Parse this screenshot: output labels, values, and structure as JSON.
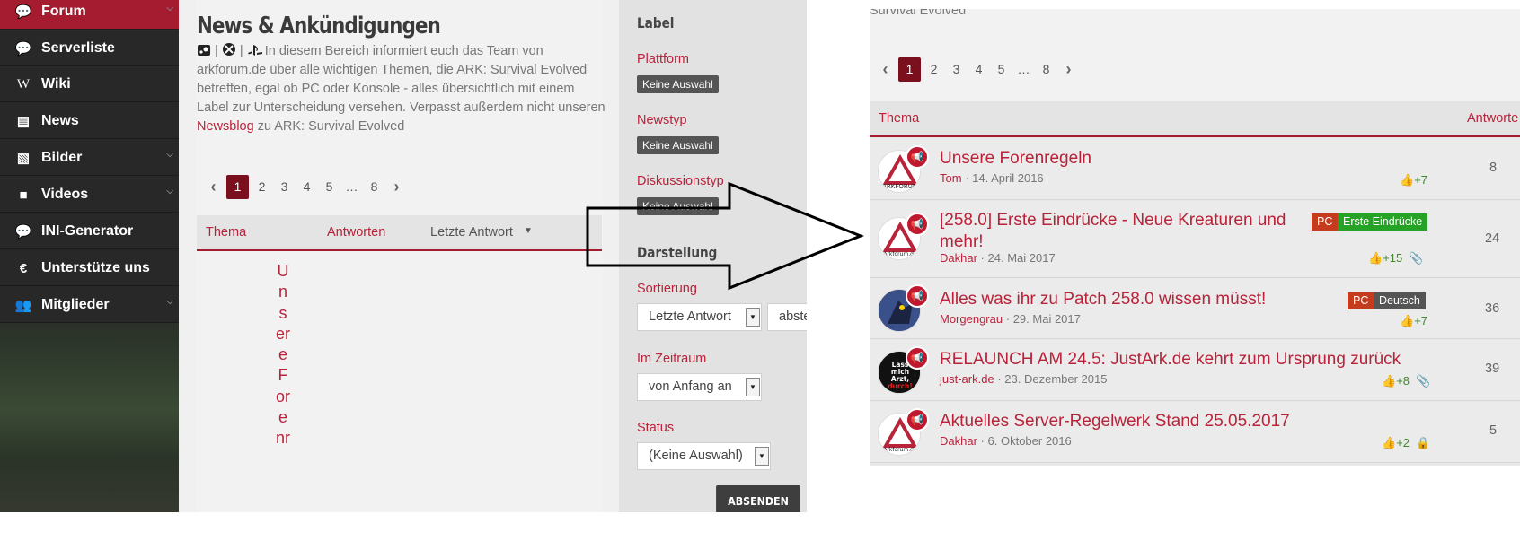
{
  "sidebar": {
    "items": [
      {
        "label": "Forum",
        "icon": "chat-icon",
        "active": true
      },
      {
        "label": "Serverliste",
        "icon": "chat-icon"
      },
      {
        "label": "Wiki",
        "icon": "wikipedia-icon"
      },
      {
        "label": "News",
        "icon": "book-icon"
      },
      {
        "label": "Bilder",
        "icon": "image-icon"
      },
      {
        "label": "Videos",
        "icon": "video-camera-icon"
      },
      {
        "label": "INI-Generator",
        "icon": "chat-icon"
      },
      {
        "label": "Unterstütze uns",
        "icon": "euro-icon"
      },
      {
        "label": "Mitglieder",
        "icon": "users-icon"
      }
    ]
  },
  "board": {
    "title": "News & Ankündigungen",
    "sep1": "|",
    "sep2": "|",
    "desc_part1": "In diesem Bereich informiert euch das Team von arkforum.de über alle wichtigen Themen, die ARK: Survival Evolved betreffen, egal ob PC oder Konsole - alles übersichtlich mit einem Label zur Unterscheidung versehen. Verpasst außerdem nicht unseren",
    "desc_link": "Newsblog",
    "desc_part2": "zu ARK: Survival Evolved"
  },
  "pagination": {
    "pages": [
      "1",
      "2",
      "3",
      "4",
      "5",
      "…",
      "8"
    ],
    "current": "1"
  },
  "left_table": {
    "col_thema": "Thema",
    "col_antworten": "Antworten",
    "col_letzte": "Letzte Antwort",
    "squeezed_title": "UnsereForenr"
  },
  "filter": {
    "label_heading": "Label",
    "plattform_label": "Plattform",
    "plattform_value": "Keine Auswahl",
    "newstyp_label": "Newstyp",
    "newstyp_value": "Keine Auswahl",
    "diskussion_label": "Diskussionstyp",
    "diskussion_value": "Keine Auswahl",
    "darstellung_heading": "Darstellung",
    "sortierung_label": "Sortierung",
    "sortierung_value": "Letzte Antwort",
    "order_value": "abste",
    "zeitraum_label": "Im Zeitraum",
    "zeitraum_value": "von Anfang an",
    "status_label": "Status",
    "status_value": "(Keine Auswahl)",
    "submit": "ABSENDEN"
  },
  "right": {
    "top_text": "Survival Evolved",
    "col_thema": "Thema",
    "col_antworten": "Antworte",
    "threads": [
      {
        "title": "Unsere Forenregeln",
        "author": "Tom",
        "date": "14. April 2016",
        "likes": "+7",
        "replies": "8",
        "tags": []
      },
      {
        "title": "[258.0] Erste Eindrücke - Neue Kreaturen und mehr!",
        "author": "Dakhar",
        "date": "24. Mai 2017",
        "likes": "+15",
        "replies": "24",
        "tags": [
          "PC",
          "Erste Eindrücke"
        ]
      },
      {
        "title": "Alles was ihr zu Patch 258.0 wissen müsst!",
        "author": "Morgengrau",
        "date": "29. Mai 2017",
        "likes": "+7",
        "replies": "36",
        "tags": [
          "PC",
          "Deutsch"
        ]
      },
      {
        "title": "RELAUNCH AM 24.5: JustArk.de kehrt zum Ursprung zurück",
        "author": "just-ark.de",
        "date": "23. Dezember 2015",
        "likes": "+8",
        "replies": "39",
        "tags": []
      },
      {
        "title": "Aktuelles Server-Regelwerk Stand 25.05.2017",
        "author": "Dakhar",
        "date": "6. Oktober 2016",
        "likes": "+2",
        "replies": "5",
        "tags": []
      }
    ],
    "meta_sep": "·"
  },
  "colors": {
    "accent": "#b8233a",
    "sidebar_active": "#a51b2f",
    "like_green": "#3d8a2a"
  }
}
